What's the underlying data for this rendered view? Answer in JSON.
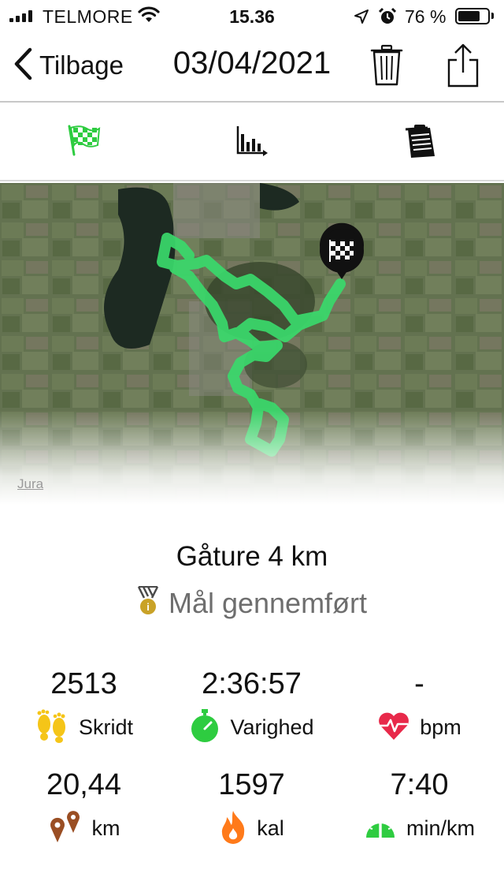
{
  "status_bar": {
    "carrier": "TELMORE",
    "time": "15.36",
    "battery_percent": "76 %",
    "battery_level": 0.76,
    "icons": [
      "signal-icon",
      "wifi-icon",
      "location-arrow-icon",
      "alarm-clock-icon",
      "battery-icon"
    ]
  },
  "nav": {
    "back_label": "Tilbage",
    "title": "03/04/2021",
    "icons": [
      "chevron-left-icon",
      "trash-icon",
      "share-icon"
    ]
  },
  "tabs": [
    {
      "name": "route",
      "icon": "checkered-flag-icon",
      "active": true
    },
    {
      "name": "graph",
      "icon": "bar-chart-icon",
      "active": false
    },
    {
      "name": "notes",
      "icon": "notepad-icon",
      "active": false
    }
  ],
  "map": {
    "credit": "Jura",
    "route_color": "#39d96b",
    "finish_icon": "finish-flag-pin-icon"
  },
  "activity": {
    "title": "Gåture 4 km",
    "goal_status": "Mål gennemført",
    "goal_icon": "medal-icon"
  },
  "stats": [
    {
      "value": "2513",
      "label": "Skridt",
      "icon": "footprints-icon"
    },
    {
      "value": "2:36:57",
      "label": "Varighed",
      "icon": "stopwatch-icon"
    },
    {
      "value": "-",
      "label": "bpm",
      "icon": "heart-rate-icon"
    },
    {
      "value": "20,44",
      "label": "km",
      "icon": "location-pins-icon"
    },
    {
      "value": "1597",
      "label": "kal",
      "icon": "flame-icon"
    },
    {
      "value": "7:40",
      "label": "min/km",
      "icon": "speedometer-icon"
    }
  ],
  "colors": {
    "accent_green": "#2ecc40",
    "heart_red": "#e8294a",
    "footprint_yellow": "#f5c518",
    "pin_brown": "#9a4e23",
    "flame_orange": "#ff7a1a",
    "medal_gold": "#c9a227",
    "goal_text_gray": "#6e6e6e"
  }
}
